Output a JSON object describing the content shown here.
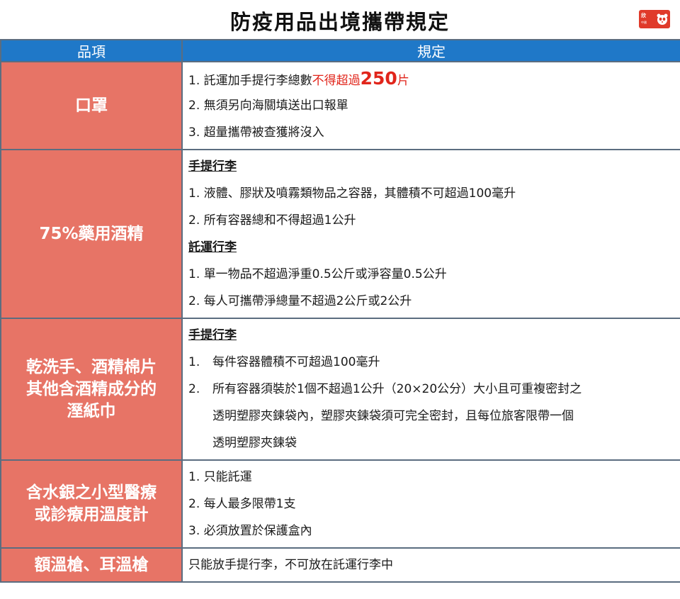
{
  "title": "防疫用品出境攜帶規定",
  "logo": {
    "brand": "欣",
    "sub": "中國"
  },
  "colors": {
    "header": "#1f78c8",
    "item": "#e77466",
    "highlight": "#e1251b"
  },
  "header": {
    "col_item": "品項",
    "col_rule": "規定"
  },
  "rows": [
    {
      "item": "口罩",
      "lines": [
        {
          "pre": "1. 託運加手提行李總數",
          "red": "不得超過",
          "big": "250",
          "red2": "片"
        },
        "2. 無須另向海關填送出口報單",
        "3. 超量攜帶被查獲將沒入"
      ]
    },
    {
      "item": "75%藥用酒精",
      "lines": [
        "手提行李",
        "1. 液體、膠狀及噴霧類物品之容器，其體積不可超過100毫升",
        "2. 所有容器總和不得超過1公升",
        "託運行李",
        "1. 單一物品不超過淨重0.5公斤或淨容量0.5公升",
        "2. 每人可攜帶淨總量不超過2公斤或2公升"
      ]
    },
    {
      "item": [
        "乾洗手、酒精棉片",
        "其他含酒精成分的",
        "溼紙巾"
      ],
      "lines": [
        "手提行李",
        {
          "num": "1.",
          "text": "每件容器體積不可超過100毫升"
        },
        {
          "num": "2.",
          "text": "所有容器須裝於1個不超過1公升（20×20公分）大小且可重複密封之"
        },
        "透明塑膠夾鍊袋內，塑膠夾鍊袋須可完全密封，且每位旅客限帶一個",
        "透明塑膠夾鍊袋"
      ]
    },
    {
      "item": [
        "含水銀之小型醫療",
        "或診療用溫度計"
      ],
      "lines": [
        "1. 只能託運",
        "2. 每人最多限帶1支",
        "3. 必須放置於保護盒內"
      ]
    },
    {
      "item": "額溫槍、耳溫槍",
      "lines": [
        "只能放手提行李，不可放在託運行李中"
      ]
    }
  ]
}
